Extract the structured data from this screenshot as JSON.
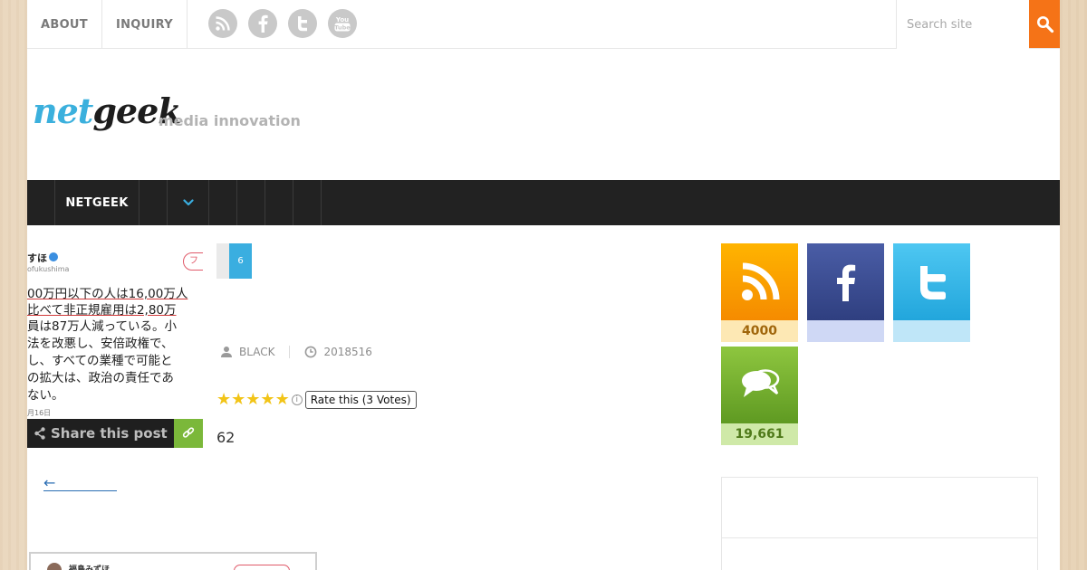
{
  "top_nav": {
    "items": [
      "ABOUT",
      "INQUIRY"
    ]
  },
  "social": [
    "rss-icon",
    "facebook-icon",
    "twitter-icon",
    "youtube-icon"
  ],
  "search": {
    "placeholder": "Search site"
  },
  "logo": {
    "part1": "net",
    "part2": "geek",
    "tagline": "media innovation"
  },
  "main_nav": {
    "brand": "NETGEEK"
  },
  "thumbnail": {
    "name": "すほ",
    "handle": "ofukushima",
    "follow": "フ",
    "lines": [
      "00万円以下の人は16,00万人",
      "比べて非正規雇用は2,80万",
      "員は87万人減っている。小",
      "法を改悪し、安倍政権で、",
      "し、すべての業種で可能と",
      "の拡大は、政治の責任であ",
      "ない。"
    ],
    "date": "月16日"
  },
  "share": {
    "label": "Share this post"
  },
  "back": {
    "label": "←"
  },
  "bottom_card": {
    "name": "福島みずほ"
  },
  "article": {
    "category_count": "6",
    "author": "BLACK",
    "date": "2018516",
    "rating_stars": 5,
    "rating_tip": "Rate this (3 Votes)",
    "count": "62"
  },
  "sidebar": {
    "tiles": [
      {
        "name": "rss",
        "value": "4000"
      },
      {
        "name": "facebook",
        "value": ""
      },
      {
        "name": "twitter",
        "value": ""
      },
      {
        "name": "comments",
        "value": "19,661"
      }
    ]
  },
  "colors": {
    "accent_orange": "#f57317",
    "nav_dark": "#222222",
    "accent_blue": "#3aaee0",
    "link_green": "#7bb83a"
  }
}
